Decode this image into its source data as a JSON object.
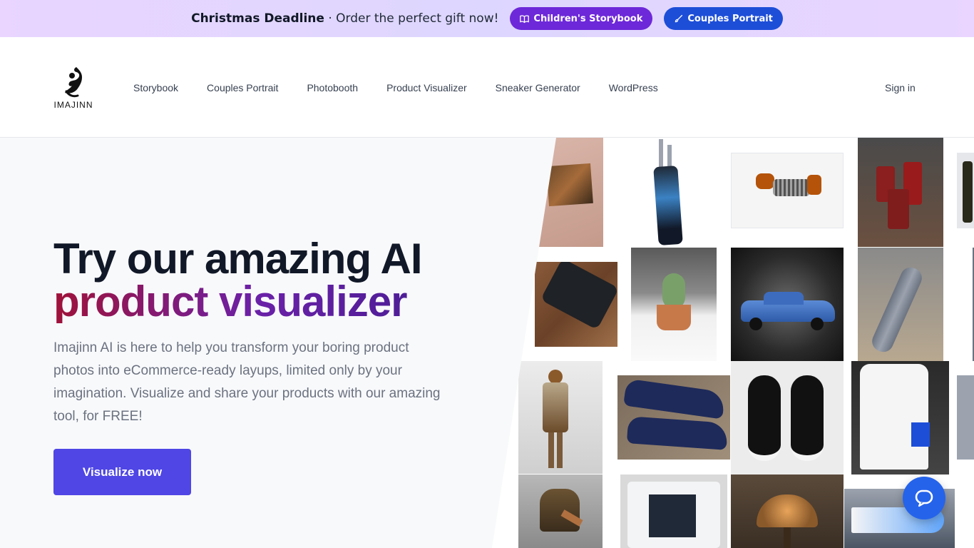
{
  "promo": {
    "headline": "Christmas Deadline",
    "separator": "·",
    "text": "Order the perfect gift now!",
    "buttons": [
      {
        "label": "Children's Storybook",
        "icon": "book-icon",
        "color": "#6d28d9"
      },
      {
        "label": "Couples Portrait",
        "icon": "brush-icon",
        "color": "#1d4ed8"
      }
    ]
  },
  "header": {
    "logo_text": "IMAJINN",
    "nav": [
      "Storybook",
      "Couples Portrait",
      "Photobooth",
      "Product Visualizer",
      "Sneaker Generator",
      "WordPress"
    ],
    "signin": "Sign in"
  },
  "hero": {
    "title_line1": "Try our amazing AI",
    "title_line2": "product visualizer",
    "description": "Imajinn AI is here to help you transform your boring product photos into eCommerce-ready layups, limited only by your imagination. Visualize and share your products with our amazing tool, for FREE!",
    "cta": "Visualize now",
    "gallery_items": [
      "painting",
      "golf-bag",
      "toy-dog",
      "red-candles",
      "bottle",
      "smartphone",
      "cactus",
      "toy-car",
      "submarine-model",
      "doll",
      "sneakers-blue",
      "sneakers-black",
      "game-console",
      "bell",
      "handheld-console",
      "tiffany-lamp",
      "boat-model"
    ]
  },
  "colors": {
    "accent": "#4f46e5",
    "promo_bg": "#e9d5ff",
    "chat": "#2563eb"
  },
  "chat": {
    "icon": "chat-bubble-icon"
  }
}
